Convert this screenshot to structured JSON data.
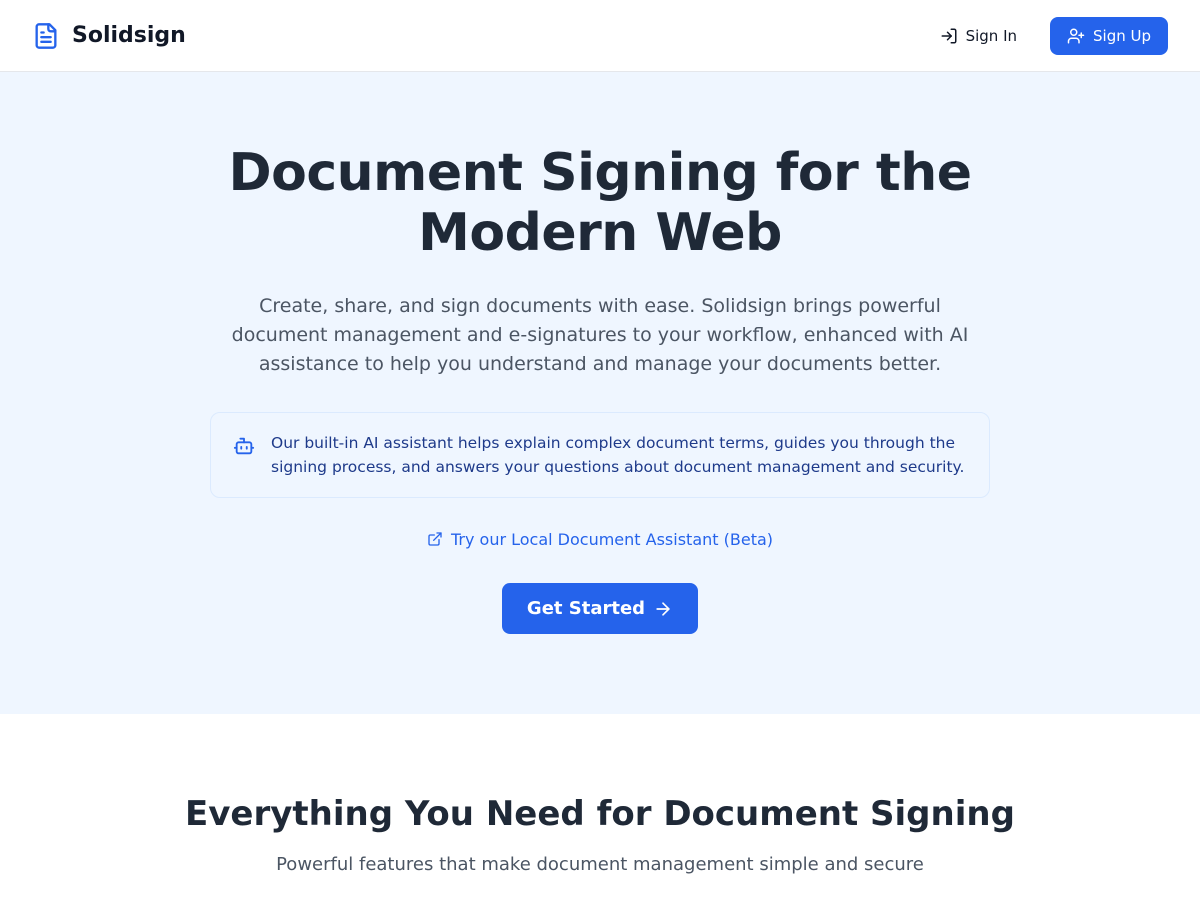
{
  "brand": {
    "name": "Solidsign"
  },
  "header": {
    "sign_in_label": "Sign In",
    "sign_up_label": "Sign Up"
  },
  "hero": {
    "title": "Document Signing for the Modern Web",
    "subtitle": "Create, share, and sign documents with ease. Solidsign brings powerful document management and e-signatures to your workflow, enhanced with AI assistance to help you understand and manage your documents better.",
    "callout": "Our built-in AI assistant helps explain complex document terms, guides you through the signing process, and answers your questions about document management and security.",
    "assistant_link_label": "Try our Local Document Assistant (Beta)",
    "cta_label": "Get Started"
  },
  "features": {
    "title": "Everything You Need for Document Signing",
    "subtitle": "Powerful features that make document management simple and secure"
  }
}
